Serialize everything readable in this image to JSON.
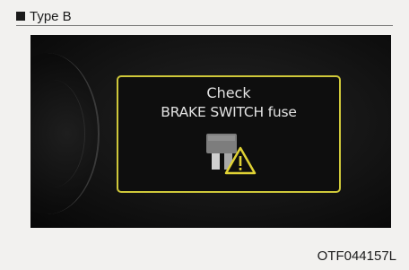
{
  "header": {
    "label": "Type B"
  },
  "display": {
    "line1": "Check",
    "line2": "BRAKE SWITCH fuse",
    "border_color": "#cfc83a",
    "icon": "fuse-warning-icon"
  },
  "caption": "OTF044157L"
}
